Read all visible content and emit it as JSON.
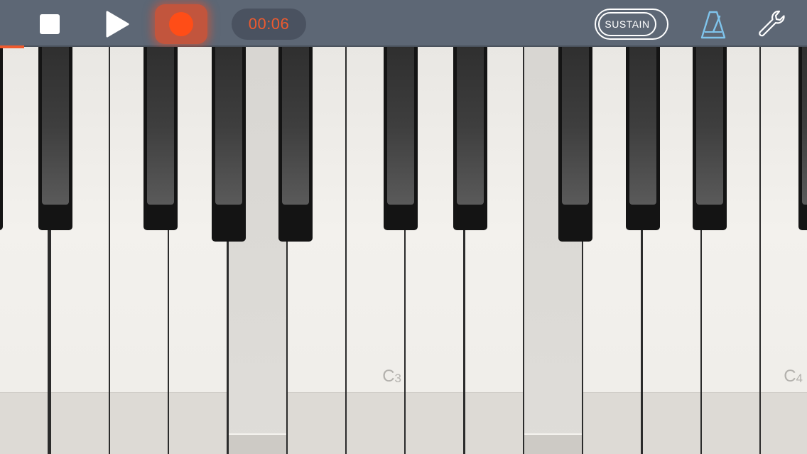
{
  "toolbar": {
    "timer": "00:06",
    "sustain_label": "SUSTAIN",
    "stop_icon": "stop-icon",
    "play_icon": "play-icon",
    "record_icon": "record-icon",
    "metronome_icon": "metronome-icon",
    "settings_icon": "wrench-icon",
    "recording_progress": 0.03
  },
  "colors": {
    "toolbar_bg": "#5d6775",
    "accent": "#ee5a2e",
    "record": "#ff4d17",
    "metronome": "#7fc4ec"
  },
  "keyboard": {
    "octave_labels": [
      {
        "note": "C",
        "octave": "3"
      },
      {
        "note": "C",
        "octave": "4"
      }
    ],
    "pressed_keys": [
      "F2",
      "C3",
      "G3",
      "D#3",
      "A3"
    ]
  }
}
